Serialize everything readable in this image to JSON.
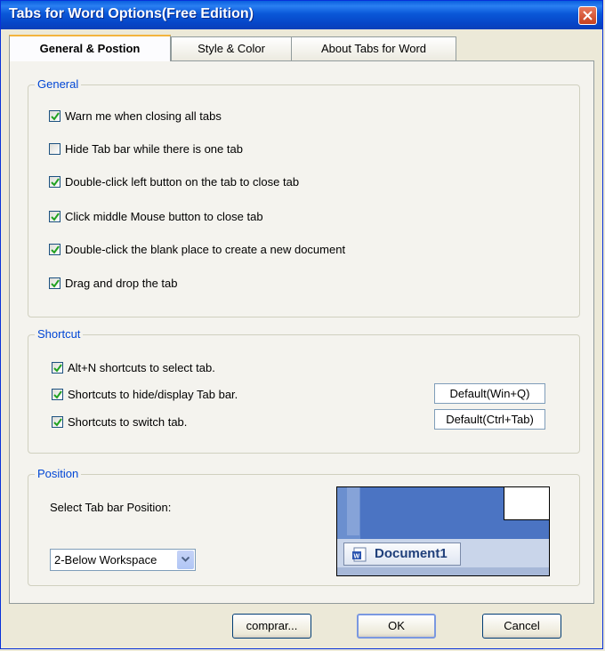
{
  "window": {
    "title": "Tabs for Word Options(Free Edition)"
  },
  "tabs": [
    {
      "label": "General & Postion",
      "active": true
    },
    {
      "label": "Style & Color",
      "active": false
    },
    {
      "label": "About Tabs for Word",
      "active": false
    }
  ],
  "general": {
    "legend": "General",
    "options": [
      {
        "label": "Warn me when closing all tabs",
        "checked": true
      },
      {
        "label": "Hide Tab bar while there is one tab",
        "checked": false
      },
      {
        "label": "Double-click left button on the tab to close tab",
        "checked": true
      },
      {
        "label": "Click middle Mouse button to close tab",
        "checked": true
      },
      {
        "label": "Double-click the blank place to create a new document",
        "checked": true
      },
      {
        "label": "Drag and drop the tab",
        "checked": true
      }
    ]
  },
  "shortcut": {
    "legend": "Shortcut",
    "options": [
      {
        "label": "Alt+N shortcuts to select tab.",
        "checked": true
      },
      {
        "label": "Shortcuts to hide/display Tab bar.",
        "checked": true,
        "key": "Default(Win+Q)"
      },
      {
        "label": "Shortcuts to switch tab.",
        "checked": true,
        "key": "Default(Ctrl+Tab)"
      }
    ]
  },
  "position": {
    "legend": "Position",
    "select_label": "Select Tab bar Position:",
    "selected": "2-Below Workspace",
    "preview_tab": "Document1"
  },
  "footer": {
    "buy": "comprar...",
    "ok": "OK",
    "cancel": "Cancel"
  },
  "colors": {
    "titlebar": "#0a58d8",
    "legend": "#0046d5",
    "check": "#21a121"
  }
}
